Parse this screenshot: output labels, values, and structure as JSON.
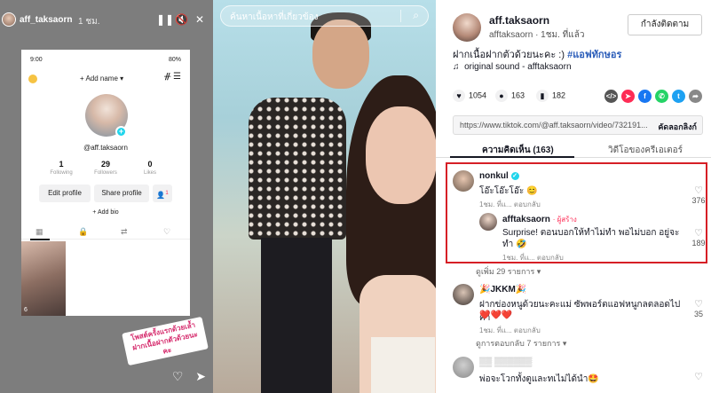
{
  "story": {
    "username": "aff_taksaorn",
    "time": "1 ชม.",
    "pause_icon": "pause-icon",
    "mute_icon": "mute-icon",
    "close_icon": "close-icon",
    "phone": {
      "status_time": "9:00",
      "status_right": "80%",
      "add_name": "+ Add name ▾",
      "handle": "@aff.taksaorn",
      "stats": [
        {
          "value": "1",
          "label": "Following"
        },
        {
          "value": "29",
          "label": "Followers"
        },
        {
          "value": "0",
          "label": "Likes"
        }
      ],
      "edit_profile": "Edit profile",
      "share_profile": "Share profile",
      "add_bio": "+ Add bio",
      "thumb_count": "6",
      "notif_count": "1"
    },
    "sticker_text": "โพสต์ครั้งแรกด้วยเล้ำ ฝากเนื้อฝากตัวด้วยนะคะ",
    "bottom_icons": [
      "heart-icon",
      "send-icon"
    ]
  },
  "video": {
    "search_placeholder": "ค้นหาเนื้อหาที่เกี่ยวข้อง"
  },
  "panel": {
    "author_name": "aff.taksaorn",
    "author_sub": "afftaksaorn · 1ชม. ที่แล้ว",
    "follow_label": "กำลังติดตาม",
    "caption": "ฝากเนื้อฝากตัวด้วยนะคะ :)",
    "caption_tag": "#แอฟทักษอร",
    "sound": "original sound - afftaksaorn",
    "likes": "1054",
    "comments": "163",
    "saves": "182",
    "share_icons": [
      {
        "icon": "embed-icon",
        "glyph": "</>",
        "color": "#555555"
      },
      {
        "icon": "send-icon",
        "glyph": "➤",
        "color": "#fe2c55"
      },
      {
        "icon": "facebook-icon",
        "glyph": "f",
        "color": "#1877f2"
      },
      {
        "icon": "whatsapp-icon",
        "glyph": "✆",
        "color": "#25d366"
      },
      {
        "icon": "twitter-icon",
        "glyph": "t",
        "color": "#1da1f2"
      },
      {
        "icon": "share-icon",
        "glyph": "➦",
        "color": "#888888"
      }
    ],
    "url": "https://www.tiktok.com/@aff.taksaorn/video/732191...",
    "copy_link": "คัดลอกลิงก์",
    "tab_comments": "ความคิดเห็น (163)",
    "tab_creator_videos": "วิดีโอของครีเอเตอร์",
    "comments_list": [
      {
        "user": "nonkul",
        "text": "โอ๊ะโอ๊ะโอ๊ะ 😊",
        "meta": "1ชม. ที่แ...   ตอบกลับ",
        "likes": "376",
        "reply": {
          "user": "afftaksaorn",
          "role": "· ผู้สร้าง",
          "text": "Surprise! ตอนบอกให้ทำไม่ทำ พอไม่บอก อยู่จะทำ 🤣",
          "meta": "1ชม. ที่แ...   ตอบกลับ",
          "likes": "189"
        },
        "more": "ดูเพิ่ม 29 รายการ ▾"
      },
      {
        "user": "🎉JKKM🎉",
        "text": "ฝากข่องหนูด้วยนะคะแม่ ซัพพอร์ตแอฟหนูกลตลอดไปค่า",
        "text2": "❤️❤️❤️",
        "meta": "1ชม. ที่แ...   ตอบกลับ",
        "likes": "35",
        "more": "ดูการตอบกลับ 7 รายการ ▾"
      },
      {
        "user": "▒▒ ▒▒▒▒▒▒",
        "text": "พ่อจะโวกทั้งตูและทเไม่ได้นำ🤩",
        "likes": ""
      }
    ]
  }
}
